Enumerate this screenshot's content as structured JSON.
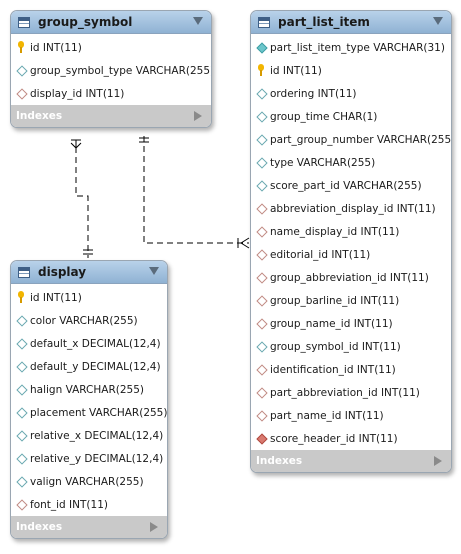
{
  "tables": {
    "group_symbol": {
      "name": "group_symbol",
      "columns": [
        {
          "label": "id INT(11)",
          "icon": "primary-key-icon"
        },
        {
          "label": "group_symbol_type VARCHAR(255)",
          "icon": "column-diamond-icon"
        },
        {
          "label": "display_id INT(11)",
          "icon": "foreign-key-diamond-icon"
        }
      ],
      "indexes_label": "Indexes"
    },
    "display": {
      "name": "display",
      "columns": [
        {
          "label": "id INT(11)",
          "icon": "primary-key-icon"
        },
        {
          "label": "color VARCHAR(255)",
          "icon": "column-diamond-icon"
        },
        {
          "label": "default_x DECIMAL(12,4)",
          "icon": "column-diamond-icon"
        },
        {
          "label": "default_y DECIMAL(12,4)",
          "icon": "column-diamond-icon"
        },
        {
          "label": "halign VARCHAR(255)",
          "icon": "column-diamond-icon"
        },
        {
          "label": "placement VARCHAR(255)",
          "icon": "column-diamond-icon"
        },
        {
          "label": "relative_x DECIMAL(12,4)",
          "icon": "column-diamond-icon"
        },
        {
          "label": "relative_y DECIMAL(12,4)",
          "icon": "column-diamond-icon"
        },
        {
          "label": "valign VARCHAR(255)",
          "icon": "column-diamond-icon"
        },
        {
          "label": "font_id INT(11)",
          "icon": "foreign-key-diamond-icon"
        }
      ],
      "indexes_label": "Indexes"
    },
    "part_list_item": {
      "name": "part_list_item",
      "columns": [
        {
          "label": "part_list_item_type VARCHAR(31)",
          "icon": "filled-diamond-icon"
        },
        {
          "label": "id INT(11)",
          "icon": "primary-key-icon"
        },
        {
          "label": "ordering INT(11)",
          "icon": "column-diamond-icon"
        },
        {
          "label": "group_time CHAR(1)",
          "icon": "column-diamond-icon"
        },
        {
          "label": "part_group_number VARCHAR(255)",
          "icon": "column-diamond-icon"
        },
        {
          "label": "type VARCHAR(255)",
          "icon": "column-diamond-icon"
        },
        {
          "label": "score_part_id VARCHAR(255)",
          "icon": "column-diamond-icon"
        },
        {
          "label": "abbreviation_display_id INT(11)",
          "icon": "foreign-key-diamond-icon"
        },
        {
          "label": "name_display_id INT(11)",
          "icon": "foreign-key-diamond-icon"
        },
        {
          "label": "editorial_id INT(11)",
          "icon": "foreign-key-diamond-icon"
        },
        {
          "label": "group_abbreviation_id INT(11)",
          "icon": "foreign-key-diamond-icon"
        },
        {
          "label": "group_barline_id INT(11)",
          "icon": "foreign-key-diamond-icon"
        },
        {
          "label": "group_name_id INT(11)",
          "icon": "foreign-key-diamond-icon"
        },
        {
          "label": "group_symbol_id INT(11)",
          "icon": "column-diamond-icon"
        },
        {
          "label": "identification_id INT(11)",
          "icon": "foreign-key-diamond-icon"
        },
        {
          "label": "part_abbreviation_id INT(11)",
          "icon": "foreign-key-diamond-icon"
        },
        {
          "label": "part_name_id INT(11)",
          "icon": "foreign-key-diamond-icon"
        },
        {
          "label": "score_header_id INT(11)",
          "icon": "foreign-key-filled-diamond-icon"
        }
      ],
      "indexes_label": "Indexes"
    }
  },
  "colors": {
    "header_top": "#b9d2ea",
    "header_bottom": "#8fb2d3",
    "indexes_bar": "#c9c9c9",
    "connector": "#000000"
  }
}
